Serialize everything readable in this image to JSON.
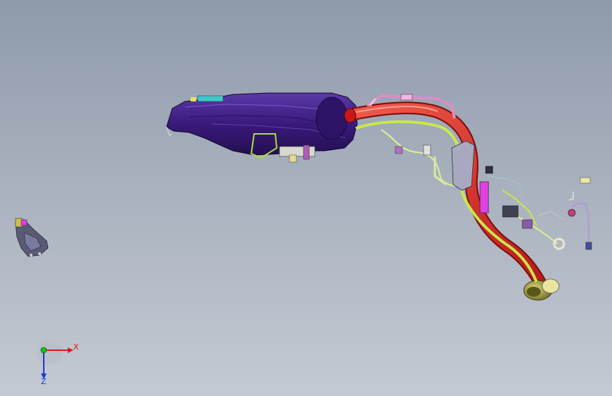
{
  "view": {
    "triad": {
      "x_label": "X",
      "z_label": "Z"
    },
    "colors": {
      "background_top": "#8f9aaa",
      "background_bottom": "#c4cad3",
      "tank": "#3a1a7a",
      "filler_pipe": "#e03030",
      "vent_line": "#c8e84a",
      "hose_pink": "#d88ec8",
      "axis_x": "#e01818",
      "axis_y": "#18c018",
      "axis_z": "#1838d8"
    }
  }
}
